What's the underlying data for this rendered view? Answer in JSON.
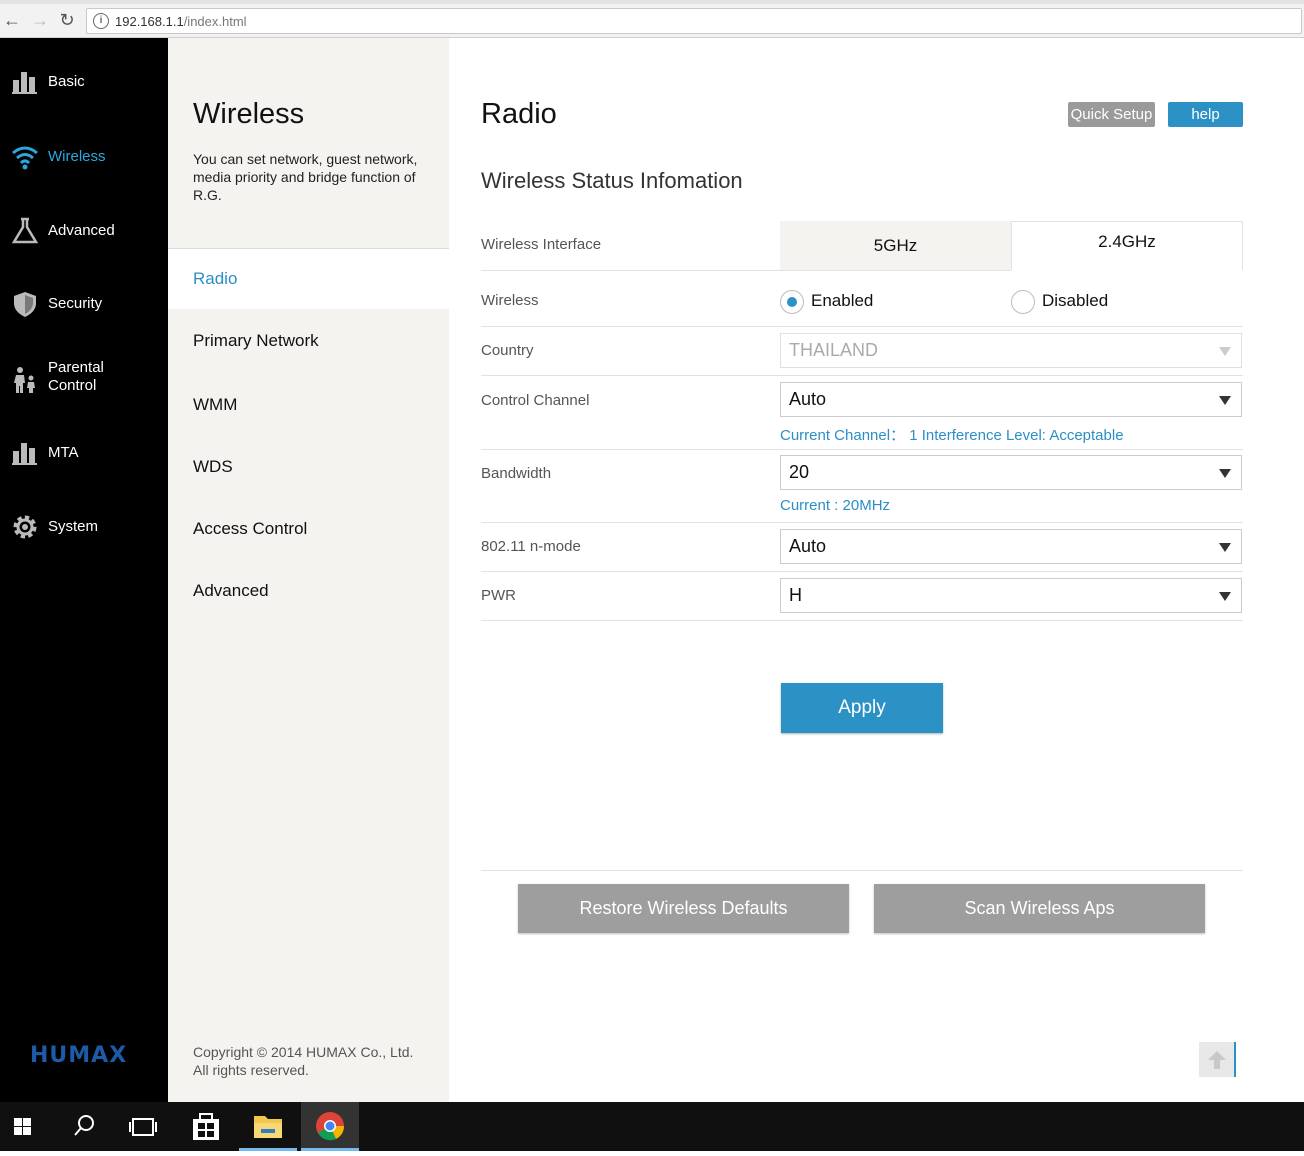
{
  "browser": {
    "url_host": "192.168.1.1",
    "url_path": "/index.html"
  },
  "sidebar": {
    "items": [
      {
        "label": "Basic",
        "icon": "bar-chart-icon"
      },
      {
        "label": "Wireless",
        "icon": "wifi-icon",
        "active": true
      },
      {
        "label": "Advanced",
        "icon": "flask-icon"
      },
      {
        "label": "Security",
        "icon": "shield-icon"
      },
      {
        "label": "Parental Control",
        "line1": "Parental",
        "line2": "Control",
        "icon": "parental-icon"
      },
      {
        "label": "MTA",
        "icon": "bar-chart-icon"
      },
      {
        "label": "System",
        "icon": "gear-icon"
      }
    ],
    "logo_text": "HUMAX"
  },
  "submenu": {
    "title": "Wireless",
    "description": "You can set network, guest network, media priority and bridge function of R.G.",
    "items": [
      "Radio",
      "Primary Network",
      "WMM",
      "WDS",
      "Access Control",
      "Advanced"
    ],
    "active_index": 0,
    "copyright_line1": "Copyright © 2014 HUMAX Co., Ltd.",
    "copyright_line2": "All rights reserved."
  },
  "main": {
    "title": "Radio",
    "quick_setup": "Quick Setup",
    "help": "help",
    "section_title": "Wireless Status Infomation",
    "rows": {
      "interface_label": "Wireless Interface",
      "wireless_label": "Wireless",
      "country_label": "Country",
      "control_channel_label": "Control Channel",
      "bandwidth_label": "Bandwidth",
      "nmode_label": "802.11 n-mode",
      "pwr_label": "PWR"
    },
    "tabs": [
      "5GHz",
      "2.4GHz"
    ],
    "active_tab": "2.4GHz",
    "radio_enabled": "Enabled",
    "radio_disabled": "Disabled",
    "country_value": "THAILAND",
    "control_channel_value": "Auto",
    "control_channel_hint": "Current Channel：  1 Interference Level: Acceptable",
    "bandwidth_value": "20",
    "bandwidth_hint": "Current : 20MHz",
    "nmode_value": "Auto",
    "pwr_value": "H",
    "apply": "Apply",
    "restore": "Restore Wireless Defaults",
    "scan": "Scan Wireless Aps"
  },
  "colors": {
    "accent": "#2c91c5",
    "sidebar_bg": "#000000",
    "submenu_bg": "#f4f3f0",
    "gray_button": "#9e9e9e"
  }
}
